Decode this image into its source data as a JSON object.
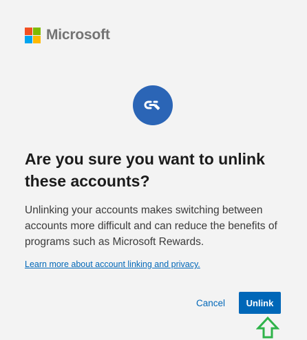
{
  "brand": {
    "name": "Microsoft",
    "logo_colors": [
      "#f25022",
      "#7fba00",
      "#00a4ef",
      "#ffb900"
    ]
  },
  "badge": {
    "icon": "unlink-icon",
    "background": "#2b65b6"
  },
  "dialog": {
    "title": "Are you sure you want to unlink these accounts?",
    "body": "Unlinking your accounts makes switching between accounts more difficult and can reduce the benefits of programs such as Microsoft Rewards.",
    "learn_more_link": "Learn more about account linking and privacy."
  },
  "actions": {
    "cancel_label": "Cancel",
    "unlink_label": "Unlink"
  },
  "colors": {
    "accent": "#0067b8",
    "link": "#0067b8",
    "page_background": "#f3f3f3",
    "arrow": "#2fb34a"
  }
}
